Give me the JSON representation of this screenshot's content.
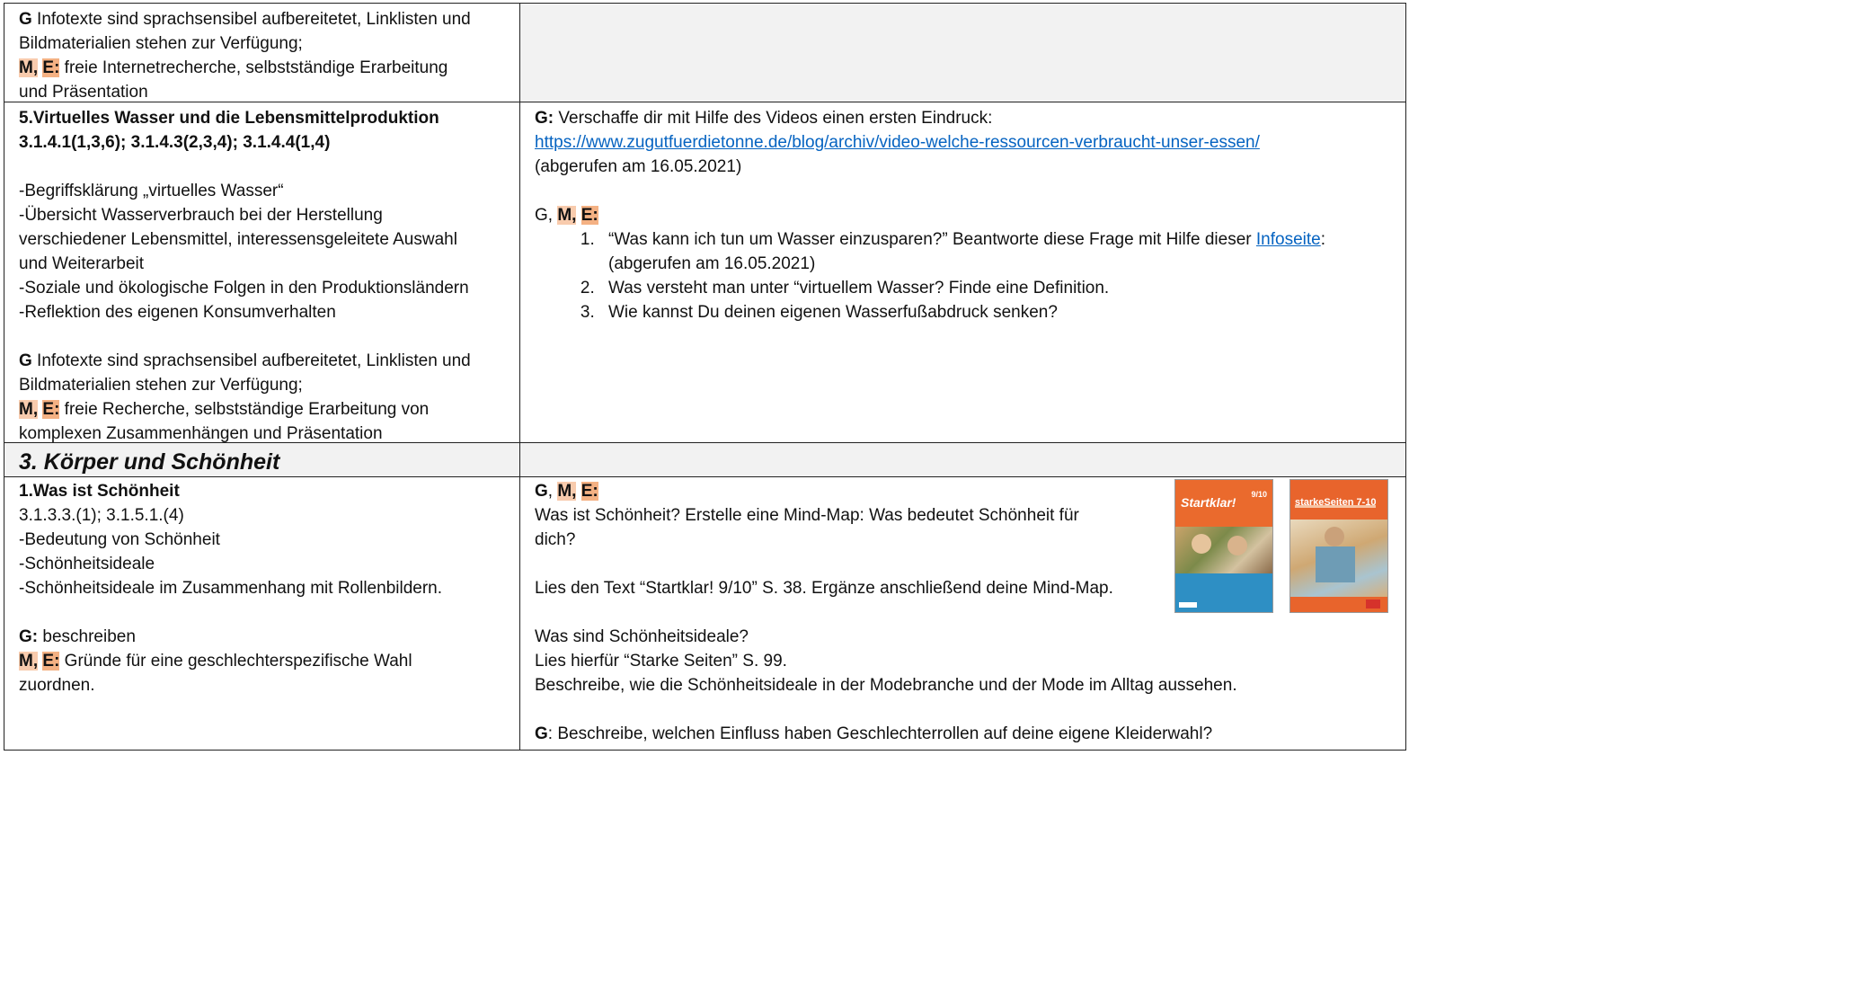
{
  "row1": {
    "left": {
      "line1_bold": "G",
      "line1": " Infotexte sind sprachsensibel aufbereitetet, Linklisten und",
      "line2": "Bildmaterialien stehen zur Verfügung;",
      "me_m": "M,",
      "me_e": "E:",
      "line3": "  freie Internetrecherche, selbstständige Erarbeitung",
      "line4": "und Präsentation"
    }
  },
  "row2": {
    "left": {
      "title": "5.Virtuelles Wasser und die Lebensmittelproduktion",
      "codes": "3.1.4.1(1,3,6); 3.1.4.3(2,3,4); 3.1.4.4(1,4)",
      "items": [
        "-Begriffsklärung „virtuelles Wasser“",
        "-Übersicht Wasserverbrauch bei der Herstellung",
        "verschiedener Lebensmittel, interessensgeleitete Auswahl",
        "und Weiterarbeit",
        "-Soziale und ökologische Folgen in den Produktionsländern",
        "-Reflektion des eigenen Konsumverhalten"
      ],
      "g_bold": "G",
      "g_line1": " Infotexte sind sprachsensibel aufbereitetet, Linklisten und",
      "g_line2": "Bildmaterialien stehen zur Verfügung;",
      "me_m": "M,",
      "me_e": "E:",
      "me_line1": " freie Recherche, selbstständige Erarbeitung von",
      "me_line2": "komplexen Zusammenhängen und Präsentation"
    },
    "right": {
      "g_label": "G:",
      "intro": " Verschaffe dir mit Hilfe des Videos einen ersten Eindruck:",
      "url": "https://www.zugutfuerdietonne.de/blog/archiv/video-welche-ressourcen-verbraucht-unser-essen/",
      "accessed": "(abgerufen am 16.05.2021)",
      "levels_g": "G,",
      "levels_m": "M,",
      "levels_e": "E:",
      "task1_text": "“Was kann ich tun um Wasser einzusparen?” Beantworte diese Frage mit Hilfe dieser ",
      "task1_link": "Infoseite",
      "task1_after": ":",
      "task1_line2": "(abgerufen am 16.05.2021)",
      "task2": "Was versteht man unter “virtuellem Wasser? Finde eine Definition.",
      "task3": "Wie kannst Du deinen eigenen Wasserfußabdruck senken?"
    }
  },
  "row3": {
    "section_title": "3. Körper und Schönheit"
  },
  "row4": {
    "left": {
      "title": "1.Was ist Schönheit",
      "codes": "3.1.3.3.(1); 3.1.5.1.(4)",
      "items": [
        "-Bedeutung von Schönheit",
        "-Schönheitsideale",
        "-Schönheitsideale im Zusammenhang mit Rollenbildern."
      ],
      "g_label": "G:",
      "g_text": " beschreiben",
      "me_m": "M,",
      "me_e": "E:",
      "me_line1": " Gründe für eine geschlechterspezifische Wahl",
      "me_line2": "zuordnen."
    },
    "right": {
      "levels_g": "G",
      "levels_sep": ", ",
      "levels_m": "M,",
      "levels_e": "E:",
      "q1_line1": "Was ist Schönheit? Erstelle eine Mind-Map: Was bedeutet Schönheit für",
      "q1_line2": "dich?",
      "q2": "Lies den Text “Startklar! 9/10” S. 38. Ergänze anschließend deine Mind-Map.",
      "q3": "Was sind Schönheitsideale?",
      "q4": "Lies hierfür “Starke Seiten” S. 99.",
      "q5": "Beschreibe, wie die Schönheitsideale in der Modebranche und der Mode im Alltag aussehen.",
      "g2_label": "G",
      "q6": ": Beschreibe, welchen Einfluss haben Geschlechterrollen auf deine eigene Kleiderwahl?",
      "book1": {
        "title": "Startklar!",
        "grade": "9/10",
        "color": "#e8642c"
      },
      "book2": {
        "title": "starkeSeiten 7-10",
        "color": "#e8642c"
      }
    }
  }
}
